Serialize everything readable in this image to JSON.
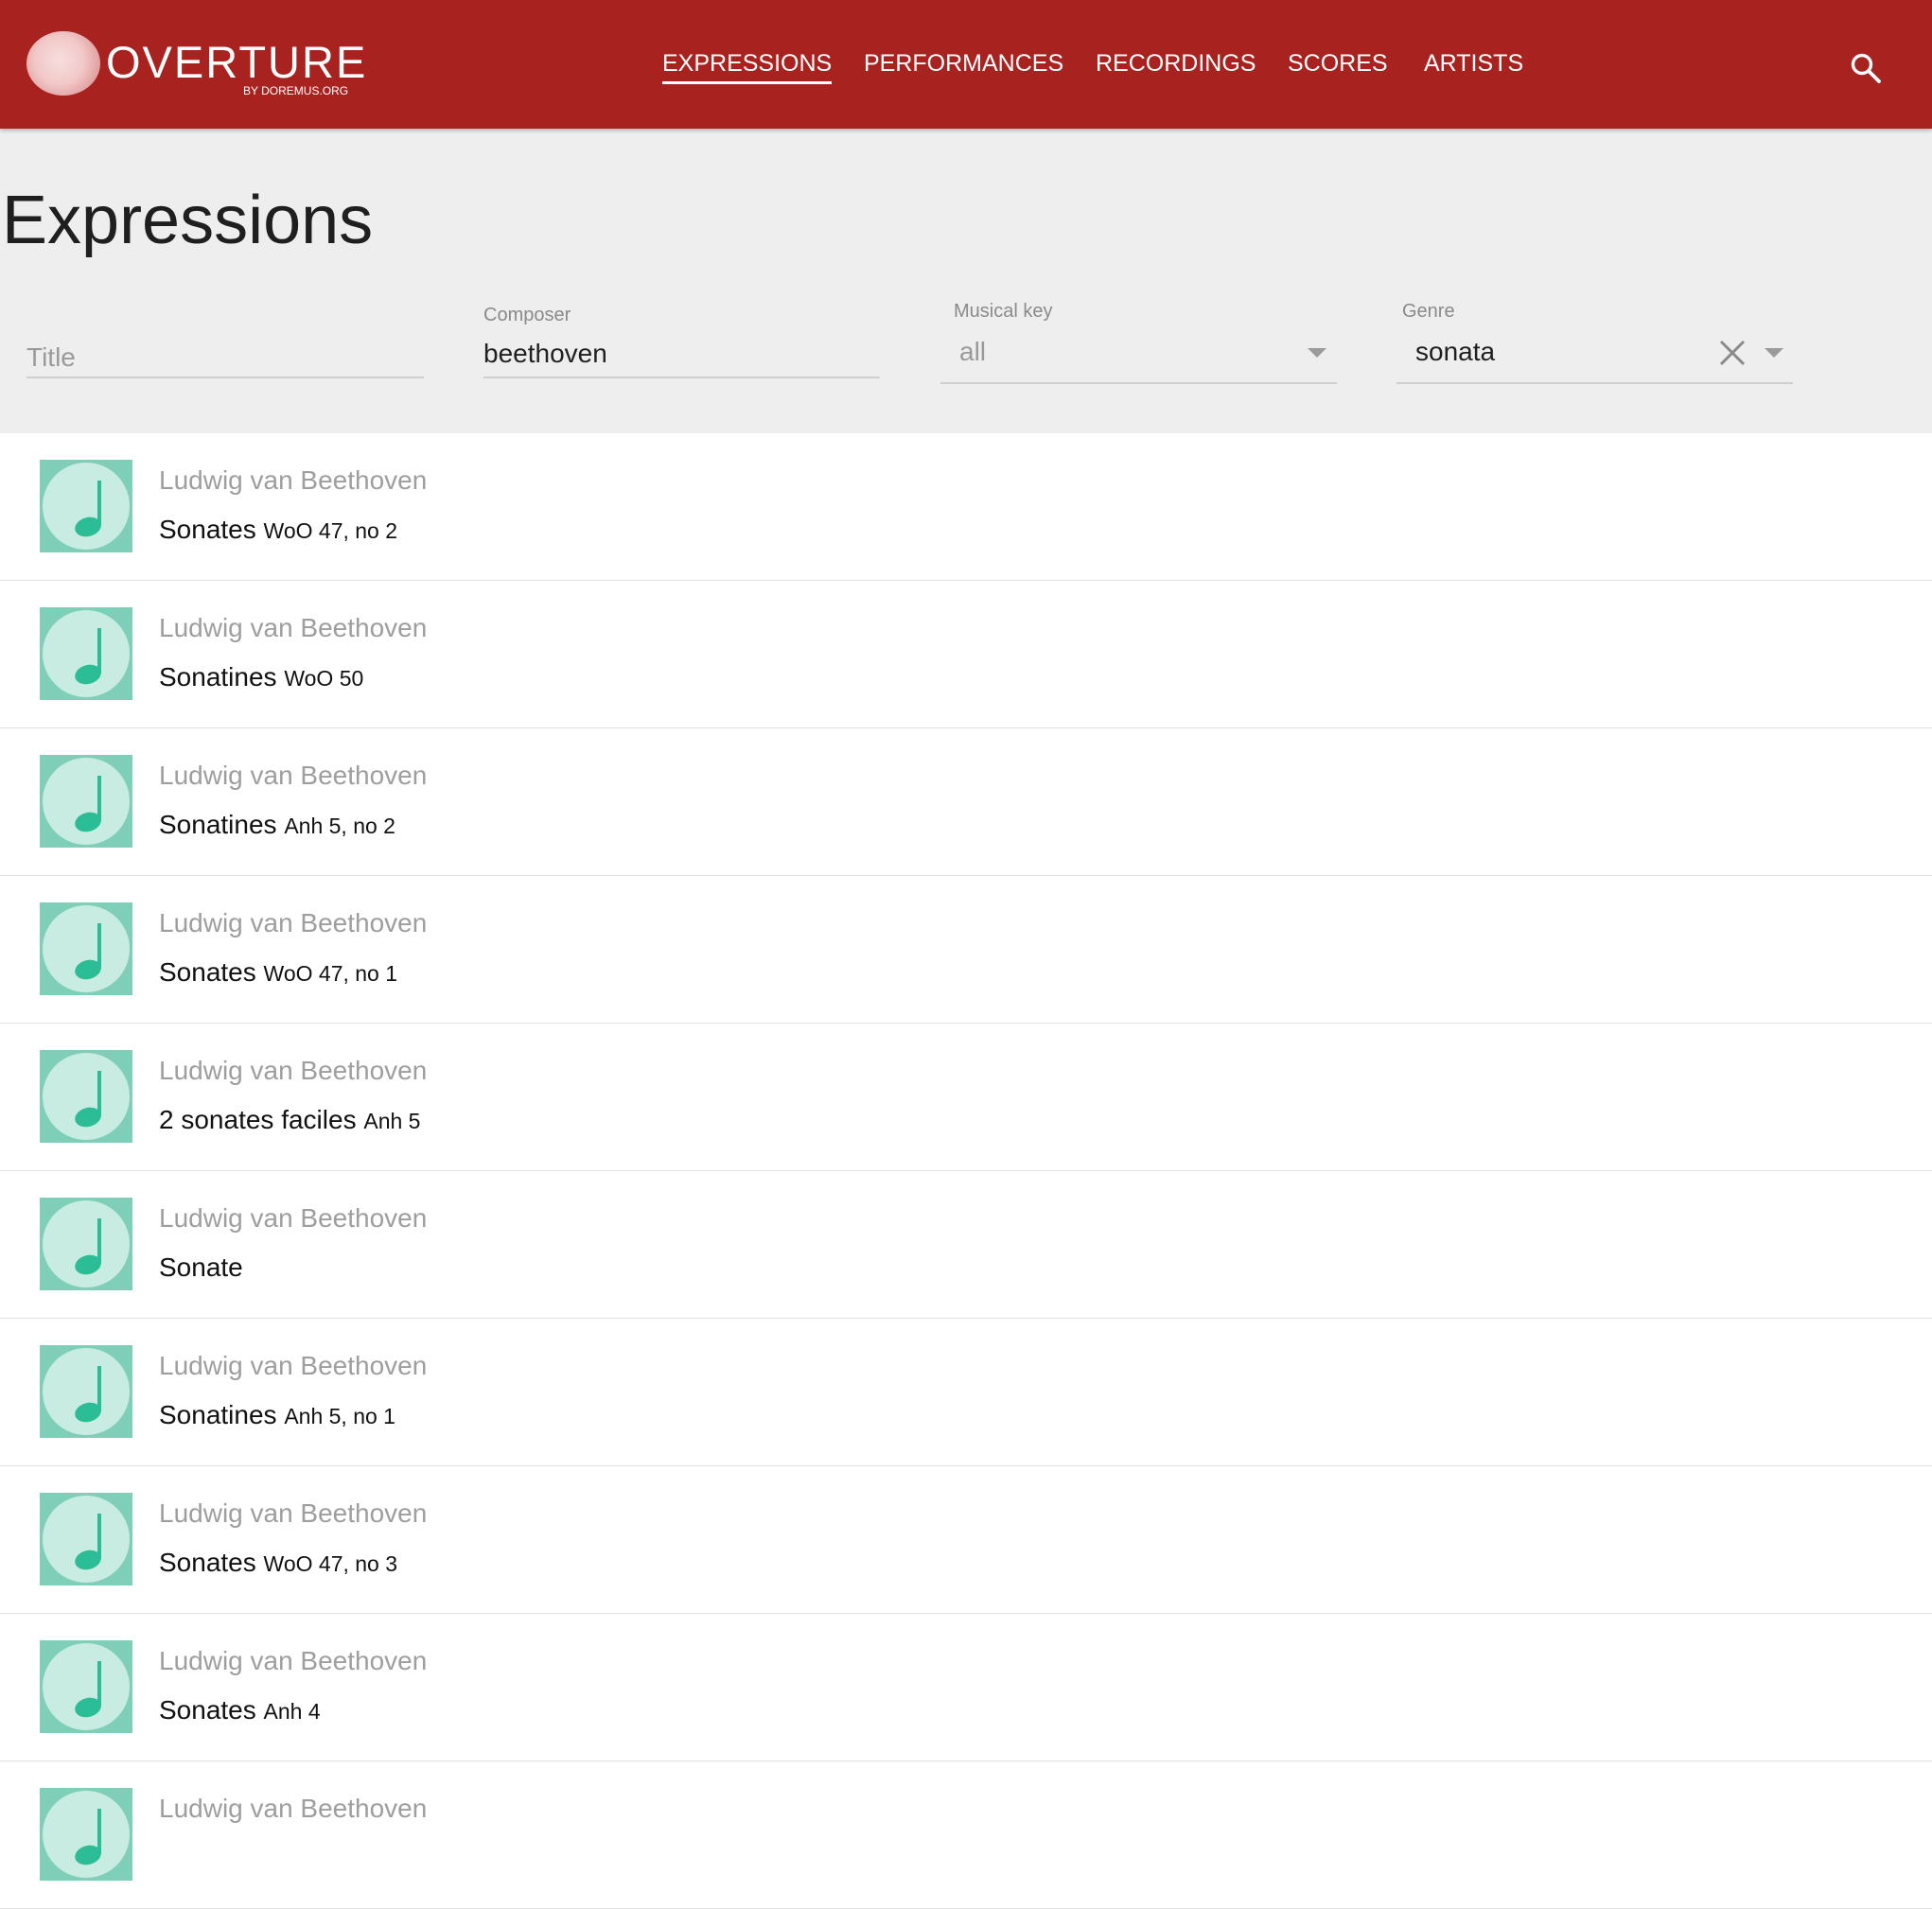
{
  "header": {
    "logo_title": "OVERTURE",
    "logo_subtitle": "BY DOREMUS.ORG",
    "nav": [
      {
        "label": "EXPRESSIONS",
        "active": true
      },
      {
        "label": "PERFORMANCES",
        "active": false
      },
      {
        "label": "RECORDINGS",
        "active": false
      },
      {
        "label": "SCORES",
        "active": false
      },
      {
        "label": "ARTISTS",
        "active": false
      }
    ],
    "search_icon": "search-icon",
    "color": "#a82320"
  },
  "page": {
    "title": "Expressions"
  },
  "filters": {
    "title": {
      "placeholder": "Title",
      "value": ""
    },
    "composer": {
      "label": "Composer",
      "value": "beethoven"
    },
    "musical_key": {
      "label": "Musical key",
      "value": "all"
    },
    "genre": {
      "label": "Genre",
      "value": "sonata"
    }
  },
  "results": [
    {
      "composer": "Ludwig van Beethoven",
      "title": "Sonates",
      "catalog": "WoO 47, no 2"
    },
    {
      "composer": "Ludwig van Beethoven",
      "title": "Sonatines",
      "catalog": "WoO 50"
    },
    {
      "composer": "Ludwig van Beethoven",
      "title": "Sonatines",
      "catalog": "Anh 5, no 2"
    },
    {
      "composer": "Ludwig van Beethoven",
      "title": "Sonates",
      "catalog": "WoO 47, no 1"
    },
    {
      "composer": "Ludwig van Beethoven",
      "title": "2 sonates faciles",
      "catalog": "Anh 5"
    },
    {
      "composer": "Ludwig van Beethoven",
      "title": "Sonate",
      "catalog": ""
    },
    {
      "composer": "Ludwig van Beethoven",
      "title": "Sonatines",
      "catalog": "Anh 5, no 1"
    },
    {
      "composer": "Ludwig van Beethoven",
      "title": "Sonates",
      "catalog": "WoO 47, no 3"
    },
    {
      "composer": "Ludwig van Beethoven",
      "title": "Sonates",
      "catalog": "Anh 4"
    },
    {
      "composer": "Ludwig van Beethoven",
      "title": "",
      "catalog": ""
    }
  ],
  "thumbnail_icon": "music-note-icon",
  "accent_colors": {
    "thumb_bg": "#7fcfb8",
    "thumb_disc": "#c8ece2",
    "note": "#2bbd95"
  }
}
